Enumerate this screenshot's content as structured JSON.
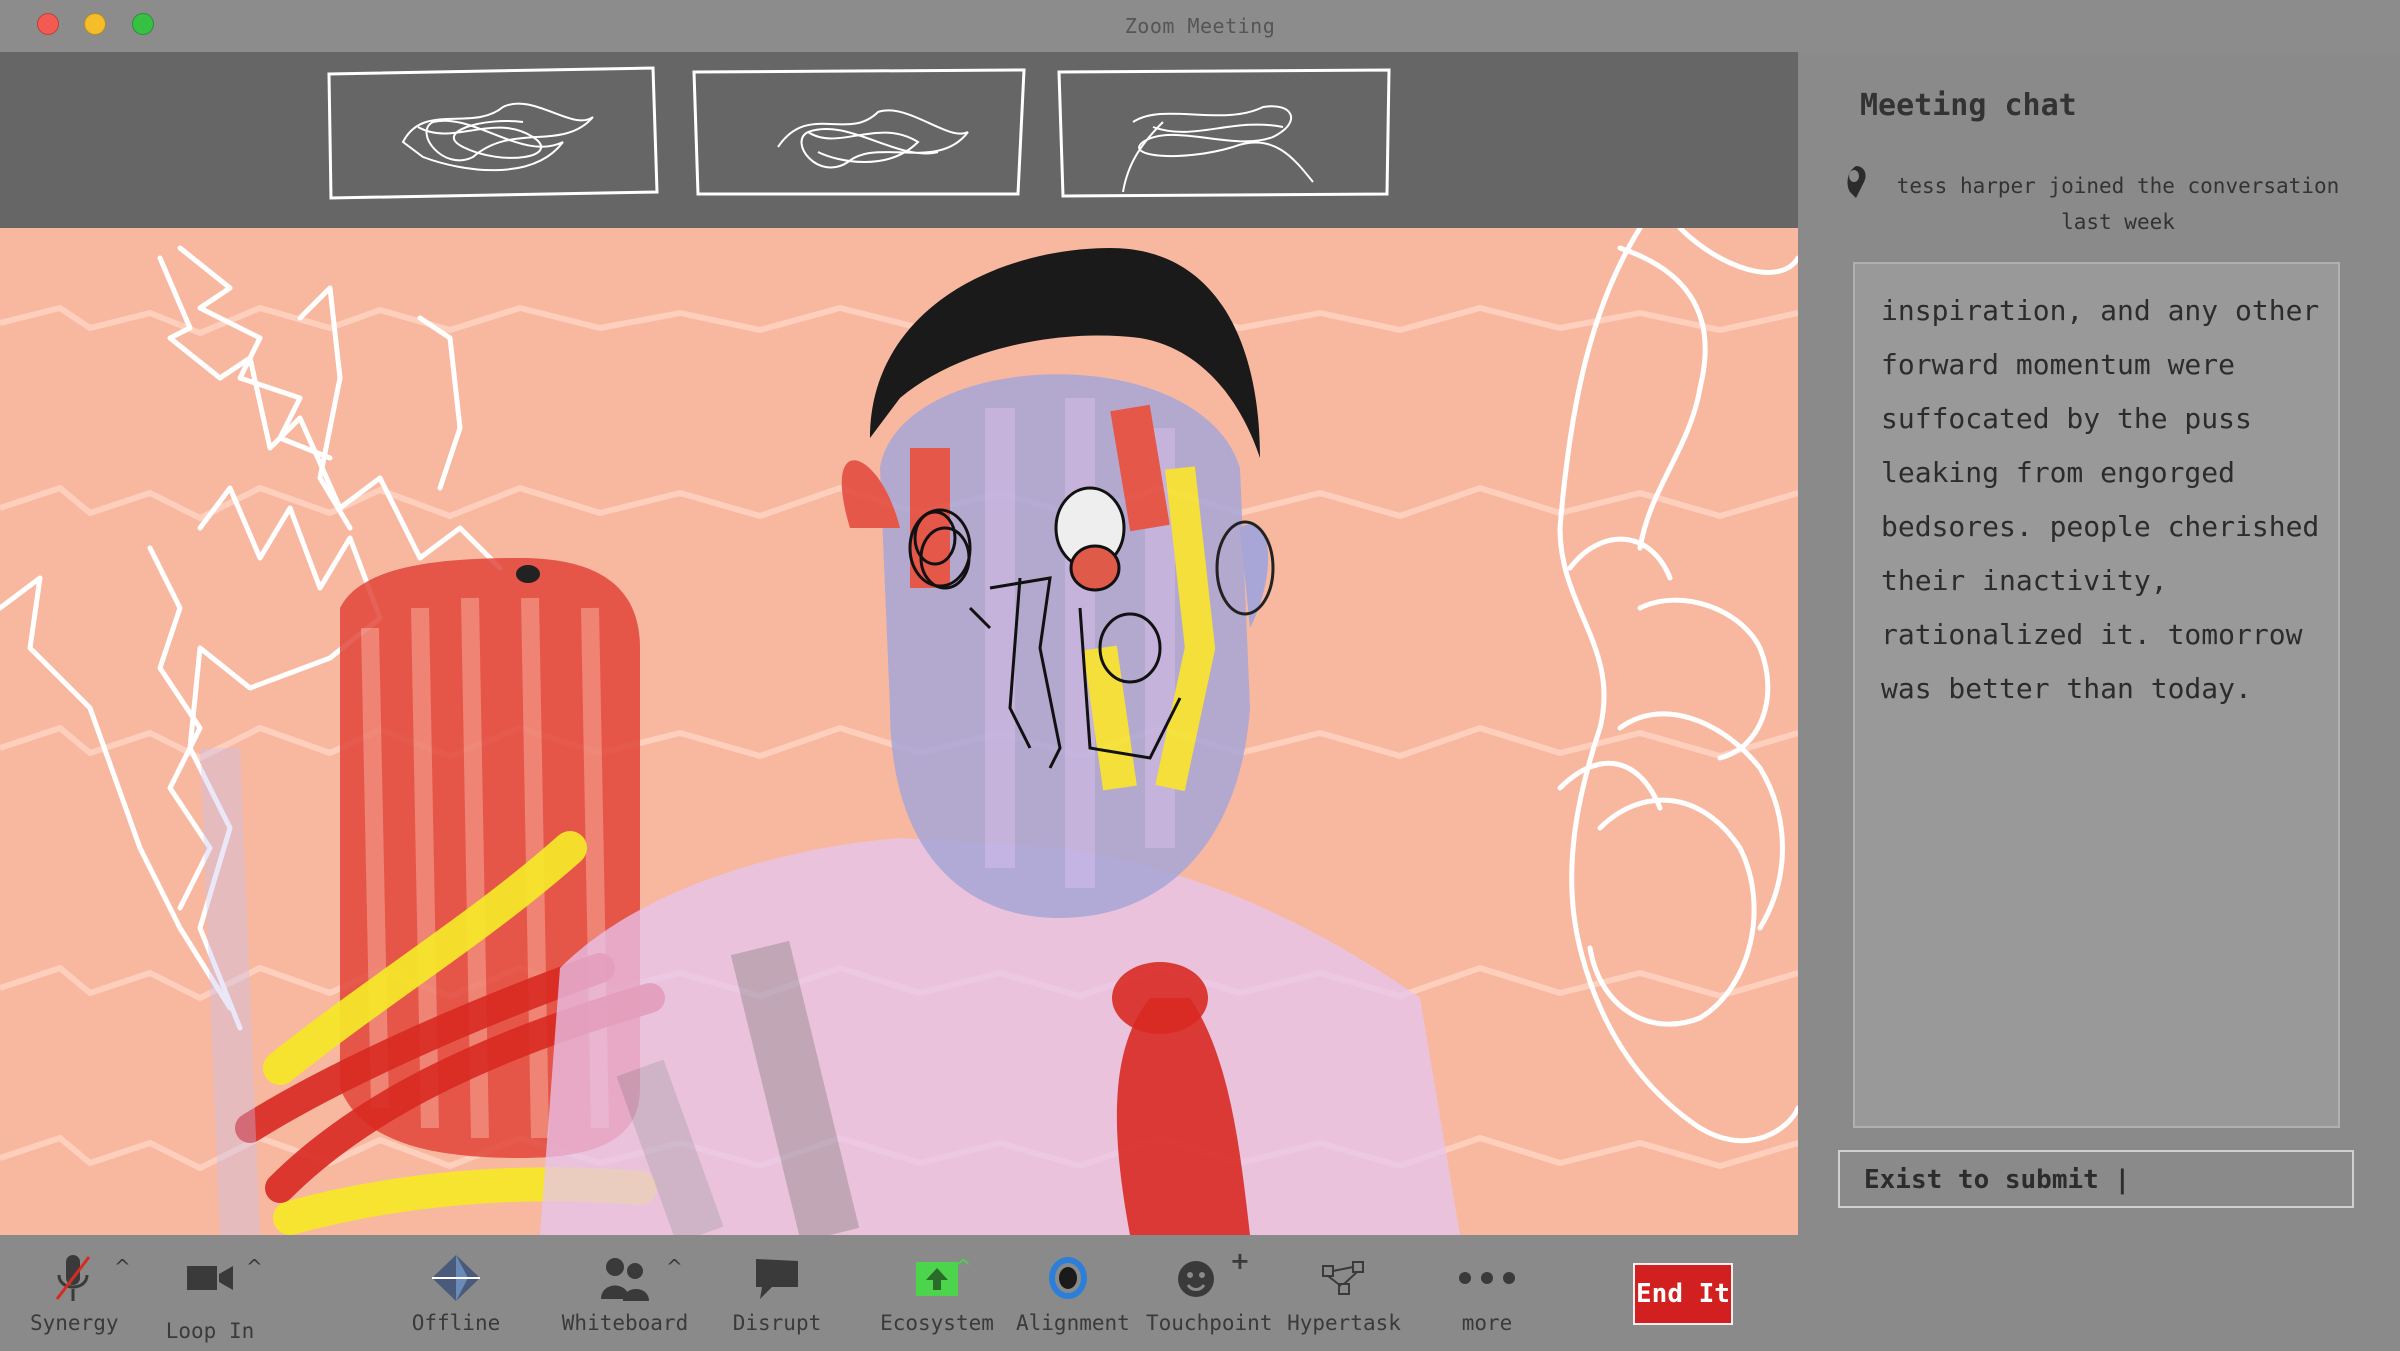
{
  "window": {
    "title": "Zoom Meeting"
  },
  "colors": {
    "video_bg": "#f8b8a0",
    "strip_bg": "#666666",
    "chat_bg": "#8a8a8a",
    "end_button": "#d21f1f",
    "ecosystem_icon": "#4cd44c",
    "alignment_icon": "#2b7fd9"
  },
  "thumbnails": [
    {
      "name": "participant-thumbnail-1"
    },
    {
      "name": "participant-thumbnail-2"
    },
    {
      "name": "participant-thumbnail-3"
    }
  ],
  "chat": {
    "title": "Meeting chat",
    "join_notice": "tess harper  joined the conversation last week",
    "message": "inspiration, and any other forward momentum were suffocated by the puss leaking from engorged bedsores. people cherished their inactivity, rationalized it. tomorrow was better than today.",
    "input_placeholder": "Exist to submit |"
  },
  "toolbar": {
    "synergy": "Synergy",
    "loop_in": "Loop In",
    "offline": "Offline",
    "whiteboard": "Whiteboard",
    "disrupt": "Disrupt",
    "ecosystem": "Ecosystem",
    "alignment": "Alignment",
    "touchpoint": "Touchpoint",
    "hypertask": "Hypertask",
    "more": "more",
    "end": "End It",
    "caret": "^",
    "touchpoint_plus": "+"
  },
  "icons": {
    "synergy": "microphone-muted-icon",
    "loop_in": "video-camera-icon",
    "offline": "diamond-icon",
    "whiteboard": "people-icon",
    "disrupt": "speech-bubble-icon",
    "ecosystem": "green-up-arrow-icon",
    "alignment": "blue-ring-icon",
    "touchpoint": "smiley-plus-icon",
    "hypertask": "task-flow-icon",
    "more": "ellipsis-icon"
  }
}
